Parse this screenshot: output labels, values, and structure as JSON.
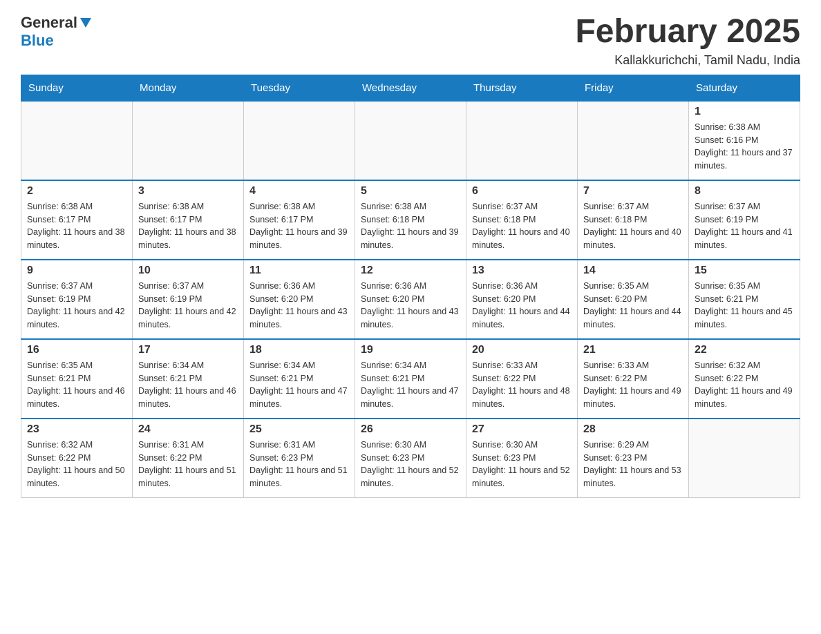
{
  "header": {
    "logo_general": "General",
    "logo_blue": "Blue",
    "month_title": "February 2025",
    "location": "Kallakkurichchi, Tamil Nadu, India"
  },
  "weekdays": [
    "Sunday",
    "Monday",
    "Tuesday",
    "Wednesday",
    "Thursday",
    "Friday",
    "Saturday"
  ],
  "weeks": [
    [
      {
        "day": "",
        "info": ""
      },
      {
        "day": "",
        "info": ""
      },
      {
        "day": "",
        "info": ""
      },
      {
        "day": "",
        "info": ""
      },
      {
        "day": "",
        "info": ""
      },
      {
        "day": "",
        "info": ""
      },
      {
        "day": "1",
        "info": "Sunrise: 6:38 AM\nSunset: 6:16 PM\nDaylight: 11 hours and 37 minutes."
      }
    ],
    [
      {
        "day": "2",
        "info": "Sunrise: 6:38 AM\nSunset: 6:17 PM\nDaylight: 11 hours and 38 minutes."
      },
      {
        "day": "3",
        "info": "Sunrise: 6:38 AM\nSunset: 6:17 PM\nDaylight: 11 hours and 38 minutes."
      },
      {
        "day": "4",
        "info": "Sunrise: 6:38 AM\nSunset: 6:17 PM\nDaylight: 11 hours and 39 minutes."
      },
      {
        "day": "5",
        "info": "Sunrise: 6:38 AM\nSunset: 6:18 PM\nDaylight: 11 hours and 39 minutes."
      },
      {
        "day": "6",
        "info": "Sunrise: 6:37 AM\nSunset: 6:18 PM\nDaylight: 11 hours and 40 minutes."
      },
      {
        "day": "7",
        "info": "Sunrise: 6:37 AM\nSunset: 6:18 PM\nDaylight: 11 hours and 40 minutes."
      },
      {
        "day": "8",
        "info": "Sunrise: 6:37 AM\nSunset: 6:19 PM\nDaylight: 11 hours and 41 minutes."
      }
    ],
    [
      {
        "day": "9",
        "info": "Sunrise: 6:37 AM\nSunset: 6:19 PM\nDaylight: 11 hours and 42 minutes."
      },
      {
        "day": "10",
        "info": "Sunrise: 6:37 AM\nSunset: 6:19 PM\nDaylight: 11 hours and 42 minutes."
      },
      {
        "day": "11",
        "info": "Sunrise: 6:36 AM\nSunset: 6:20 PM\nDaylight: 11 hours and 43 minutes."
      },
      {
        "day": "12",
        "info": "Sunrise: 6:36 AM\nSunset: 6:20 PM\nDaylight: 11 hours and 43 minutes."
      },
      {
        "day": "13",
        "info": "Sunrise: 6:36 AM\nSunset: 6:20 PM\nDaylight: 11 hours and 44 minutes."
      },
      {
        "day": "14",
        "info": "Sunrise: 6:35 AM\nSunset: 6:20 PM\nDaylight: 11 hours and 44 minutes."
      },
      {
        "day": "15",
        "info": "Sunrise: 6:35 AM\nSunset: 6:21 PM\nDaylight: 11 hours and 45 minutes."
      }
    ],
    [
      {
        "day": "16",
        "info": "Sunrise: 6:35 AM\nSunset: 6:21 PM\nDaylight: 11 hours and 46 minutes."
      },
      {
        "day": "17",
        "info": "Sunrise: 6:34 AM\nSunset: 6:21 PM\nDaylight: 11 hours and 46 minutes."
      },
      {
        "day": "18",
        "info": "Sunrise: 6:34 AM\nSunset: 6:21 PM\nDaylight: 11 hours and 47 minutes."
      },
      {
        "day": "19",
        "info": "Sunrise: 6:34 AM\nSunset: 6:21 PM\nDaylight: 11 hours and 47 minutes."
      },
      {
        "day": "20",
        "info": "Sunrise: 6:33 AM\nSunset: 6:22 PM\nDaylight: 11 hours and 48 minutes."
      },
      {
        "day": "21",
        "info": "Sunrise: 6:33 AM\nSunset: 6:22 PM\nDaylight: 11 hours and 49 minutes."
      },
      {
        "day": "22",
        "info": "Sunrise: 6:32 AM\nSunset: 6:22 PM\nDaylight: 11 hours and 49 minutes."
      }
    ],
    [
      {
        "day": "23",
        "info": "Sunrise: 6:32 AM\nSunset: 6:22 PM\nDaylight: 11 hours and 50 minutes."
      },
      {
        "day": "24",
        "info": "Sunrise: 6:31 AM\nSunset: 6:22 PM\nDaylight: 11 hours and 51 minutes."
      },
      {
        "day": "25",
        "info": "Sunrise: 6:31 AM\nSunset: 6:23 PM\nDaylight: 11 hours and 51 minutes."
      },
      {
        "day": "26",
        "info": "Sunrise: 6:30 AM\nSunset: 6:23 PM\nDaylight: 11 hours and 52 minutes."
      },
      {
        "day": "27",
        "info": "Sunrise: 6:30 AM\nSunset: 6:23 PM\nDaylight: 11 hours and 52 minutes."
      },
      {
        "day": "28",
        "info": "Sunrise: 6:29 AM\nSunset: 6:23 PM\nDaylight: 11 hours and 53 minutes."
      },
      {
        "day": "",
        "info": ""
      }
    ]
  ]
}
